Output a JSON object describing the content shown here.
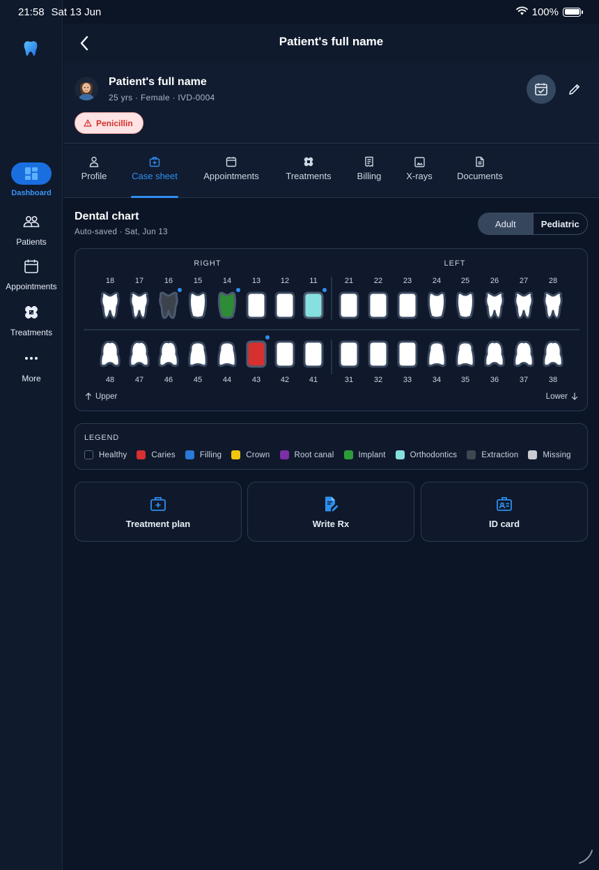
{
  "status_bar": {
    "time": "21:58",
    "date": "Sat 13 Jun",
    "battery": "100%"
  },
  "sidebar": {
    "items": [
      {
        "label": "Dashboard",
        "icon": "dashboard-icon",
        "active": true
      },
      {
        "label": "Patients",
        "icon": "patients-icon"
      },
      {
        "label": "Appointments",
        "icon": "calendar-icon"
      },
      {
        "label": "Treatments",
        "icon": "bandage-icon"
      },
      {
        "label": "More",
        "icon": "more-dots-icon"
      }
    ]
  },
  "header": {
    "title": "Patient's full name"
  },
  "patient": {
    "name": "Patient's full name",
    "meta": "25 yrs · Female · IVD-0004",
    "allergy": "Penicillin"
  },
  "tabs": [
    {
      "label": "Profile",
      "icon": "person-icon"
    },
    {
      "label": "Case sheet",
      "icon": "medical-kit-icon",
      "active": true
    },
    {
      "label": "Appointments",
      "icon": "calendar-icon"
    },
    {
      "label": "Treatments",
      "icon": "bandage-icon"
    },
    {
      "label": "Billing",
      "icon": "receipt-icon"
    },
    {
      "label": "X-rays",
      "icon": "image-icon"
    },
    {
      "label": "Documents",
      "icon": "document-icon"
    }
  ],
  "dental_chart": {
    "title": "Dental chart",
    "subtitle": "Auto-saved · Sat, Jun 13",
    "mode_options": [
      "Adult",
      "Pediatric"
    ],
    "selected_mode": "Adult",
    "labels": {
      "right": "RIGHT",
      "left": "LEFT",
      "upper": "Upper",
      "lower": "Lower"
    },
    "upper_teeth": [
      {
        "num": "18",
        "status": "healthy"
      },
      {
        "num": "17",
        "status": "healthy"
      },
      {
        "num": "16",
        "status": "extraction",
        "note": true
      },
      {
        "num": "15",
        "status": "healthy"
      },
      {
        "num": "14",
        "status": "implant",
        "note": true
      },
      {
        "num": "13",
        "status": "healthy"
      },
      {
        "num": "12",
        "status": "healthy"
      },
      {
        "num": "11",
        "status": "orthodontics",
        "note": true
      },
      {
        "num": "21",
        "status": "healthy"
      },
      {
        "num": "22",
        "status": "healthy"
      },
      {
        "num": "23",
        "status": "healthy"
      },
      {
        "num": "24",
        "status": "healthy"
      },
      {
        "num": "25",
        "status": "healthy"
      },
      {
        "num": "26",
        "status": "healthy"
      },
      {
        "num": "27",
        "status": "healthy"
      },
      {
        "num": "28",
        "status": "healthy"
      }
    ],
    "lower_teeth": [
      {
        "num": "48",
        "status": "healthy"
      },
      {
        "num": "47",
        "status": "healthy"
      },
      {
        "num": "46",
        "status": "healthy"
      },
      {
        "num": "45",
        "status": "healthy"
      },
      {
        "num": "44",
        "status": "healthy"
      },
      {
        "num": "43",
        "status": "caries",
        "note": true
      },
      {
        "num": "42",
        "status": "healthy"
      },
      {
        "num": "41",
        "status": "healthy"
      },
      {
        "num": "31",
        "status": "healthy"
      },
      {
        "num": "32",
        "status": "healthy"
      },
      {
        "num": "33",
        "status": "healthy"
      },
      {
        "num": "34",
        "status": "healthy"
      },
      {
        "num": "35",
        "status": "healthy"
      },
      {
        "num": "36",
        "status": "healthy"
      },
      {
        "num": "37",
        "status": "healthy"
      },
      {
        "num": "38",
        "status": "healthy"
      }
    ]
  },
  "legend": {
    "title": "LEGEND",
    "items": [
      {
        "label": "Healthy",
        "color": "#0c1526"
      },
      {
        "label": "Caries",
        "color": "#d63031"
      },
      {
        "label": "Filling",
        "color": "#2979d6"
      },
      {
        "label": "Crown",
        "color": "#f1c40f"
      },
      {
        "label": "Root canal",
        "color": "#7b2fa8"
      },
      {
        "label": "Implant",
        "color": "#2e9b3a"
      },
      {
        "label": "Orthodontics",
        "color": "#86e0df"
      },
      {
        "label": "Extraction",
        "color": "#3f4650"
      },
      {
        "label": "Missing",
        "color": "#c9ccd1"
      }
    ]
  },
  "actions": [
    {
      "label": "Treatment plan",
      "icon": "medical-kit-icon"
    },
    {
      "label": "Write Rx",
      "icon": "prescription-icon"
    },
    {
      "label": "ID card",
      "icon": "id-card-icon"
    }
  ],
  "colors": {
    "accent": "#2f8ff0",
    "note_dot": "#2f8ff0",
    "healthy_tooth": "#ffffff",
    "extraction_tooth": "#3d434c",
    "implant_tooth": "#2e8b36",
    "orthodontics_tooth": "#86e0df",
    "caries_tooth": "#d63031"
  }
}
